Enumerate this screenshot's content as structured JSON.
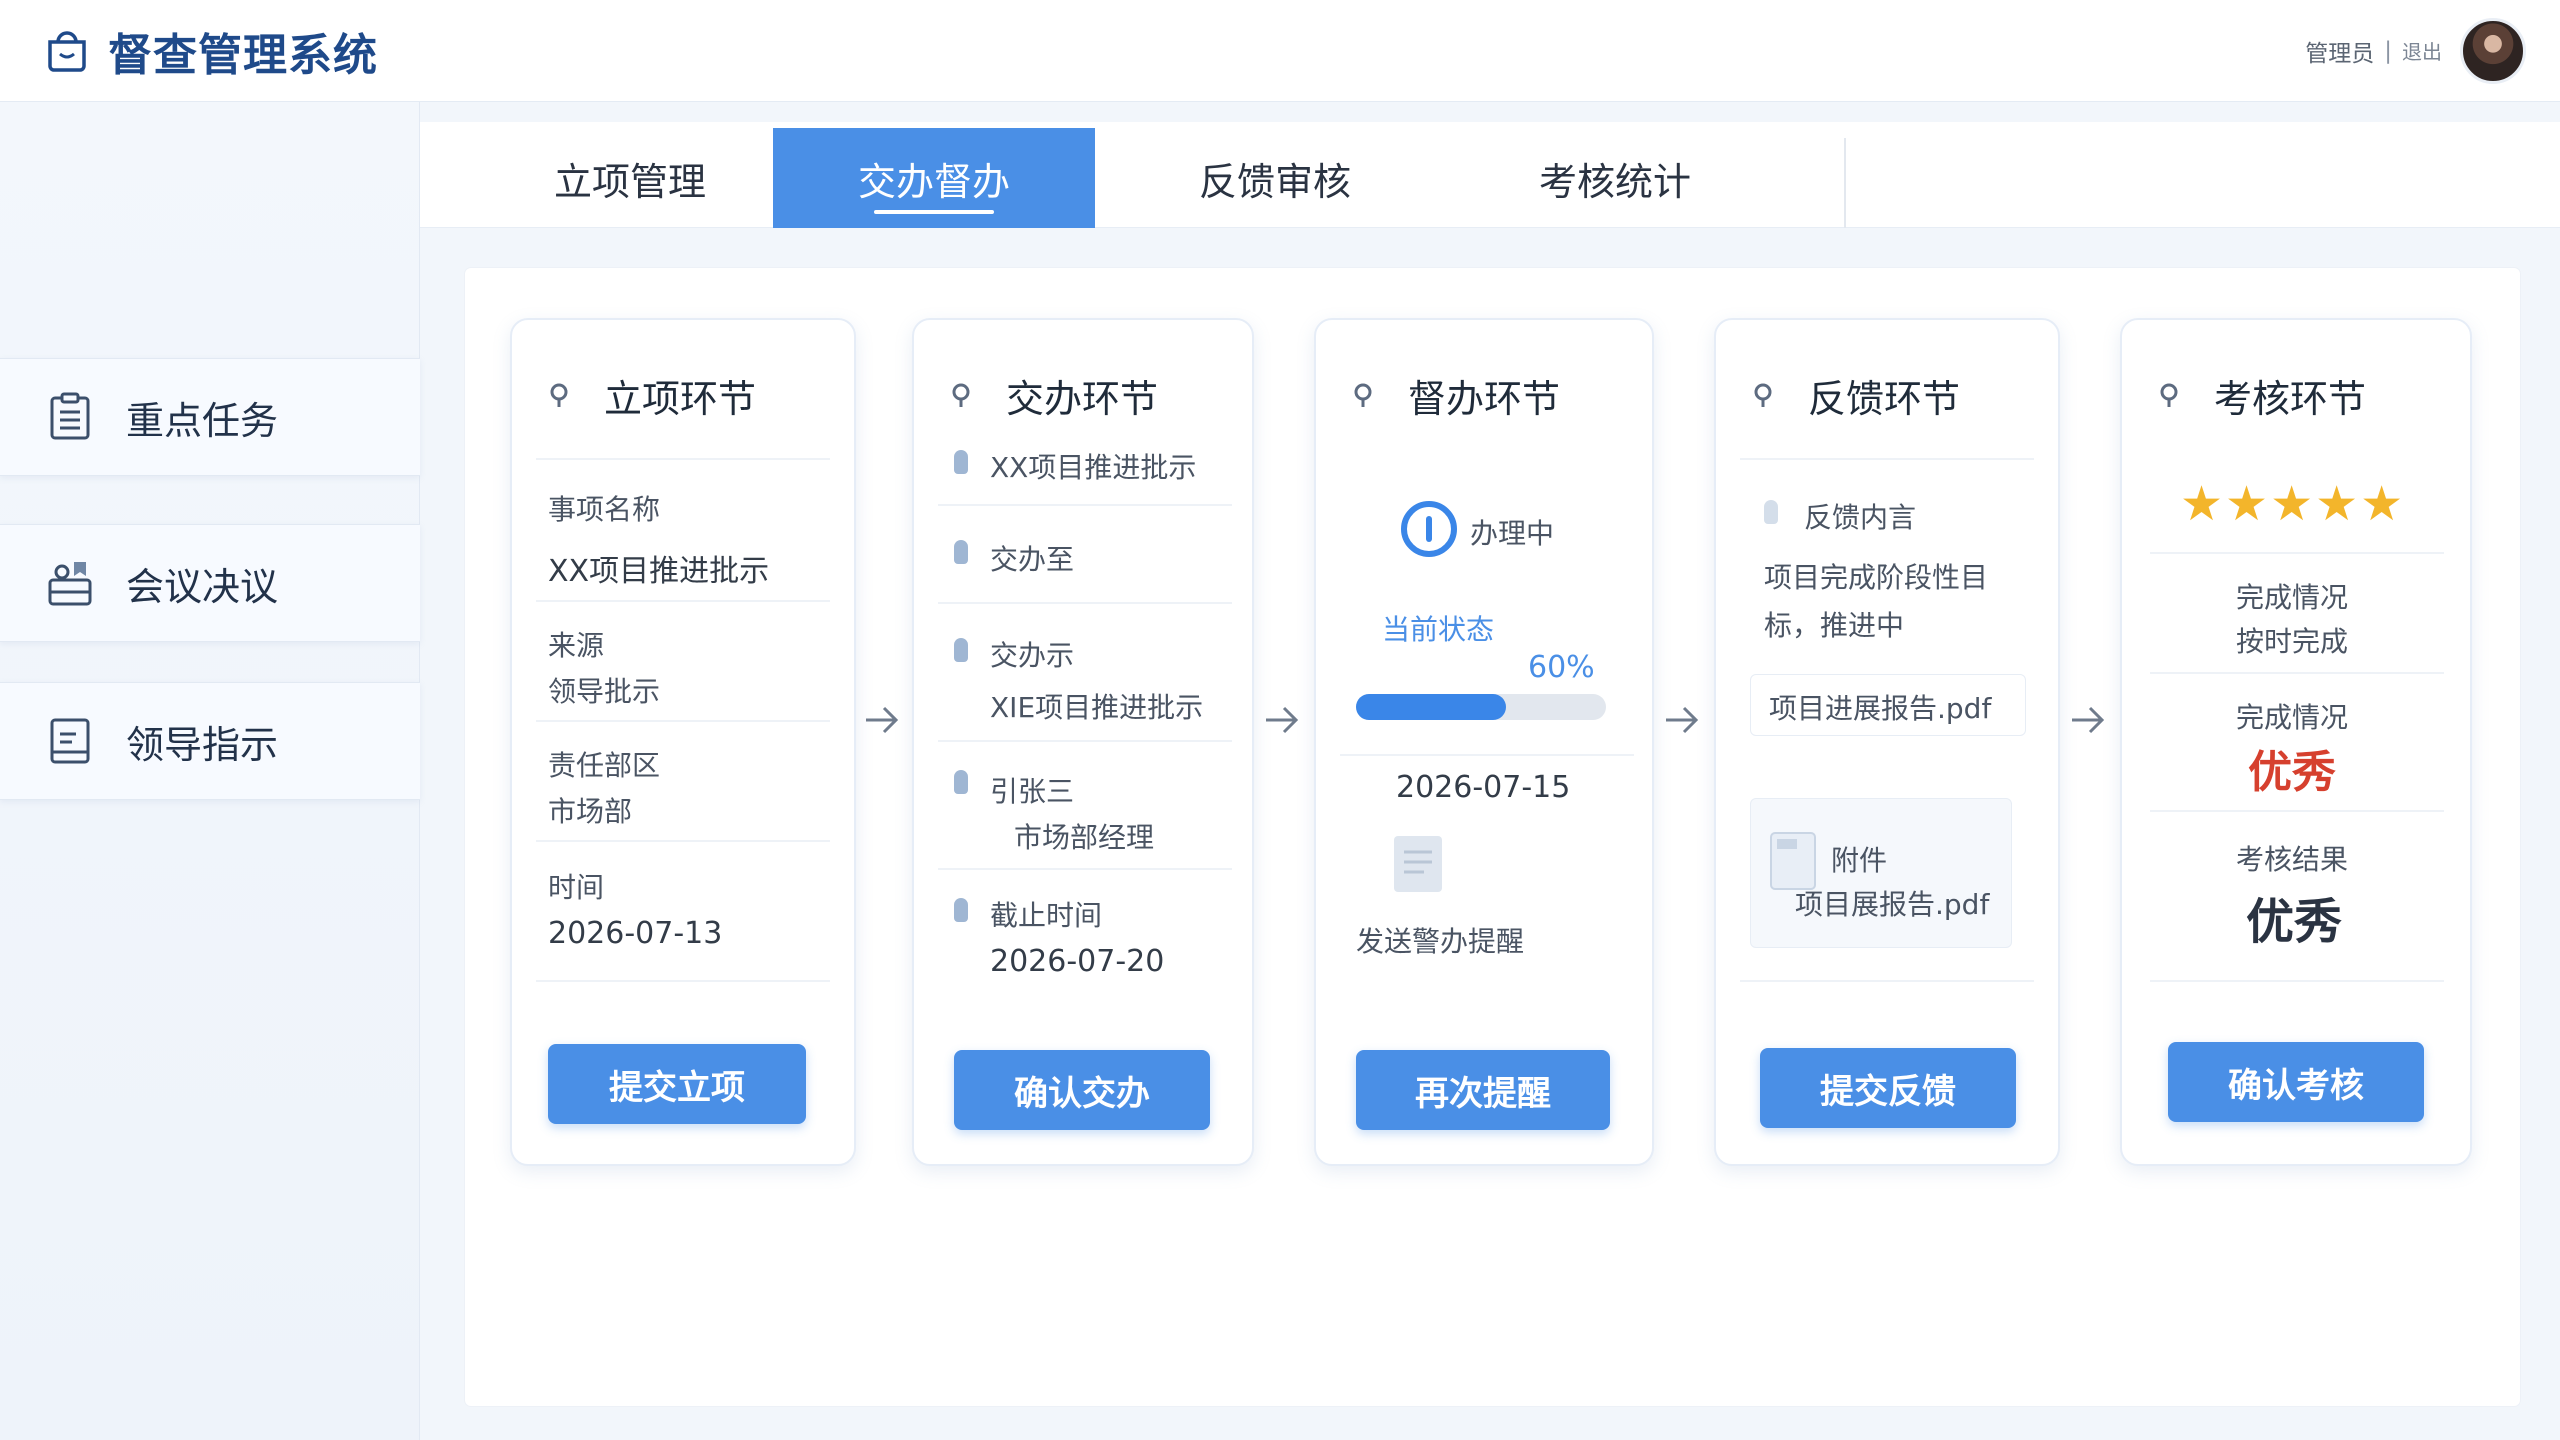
{
  "header": {
    "title": "督查管理系统",
    "user_name": "管理员",
    "separator": "|",
    "logout_label": "退出"
  },
  "sidebar": {
    "items": [
      {
        "label": "重点任务",
        "icon": "clipboard-icon"
      },
      {
        "label": "会议决议",
        "icon": "meeting-icon"
      },
      {
        "label": "领导指示",
        "icon": "document-icon"
      }
    ]
  },
  "tabs": [
    {
      "label": "立项管理",
      "active": false
    },
    {
      "label": "交办督办",
      "active": true
    },
    {
      "label": "反馈审核",
      "active": false
    },
    {
      "label": "考核统计",
      "active": false
    }
  ],
  "stages": {
    "project": {
      "title": "立项环节",
      "name_label": "事项名称",
      "name_value": "XX项目推进批示",
      "source_label": "来源",
      "source_value": "领导批示",
      "dept_label": "责任部区",
      "dept_value": "市场部",
      "time_label": "时间",
      "time_value": "2026-07-13",
      "button": "提交立项"
    },
    "assign": {
      "title": "交办环节",
      "item1": "XX项目推进批示",
      "item2": "交办至",
      "item3_label": "交办示",
      "item3_value": "XIE项目推进批示",
      "person": "引张三",
      "position": "市场部经理",
      "deadline_label": "截止时间",
      "deadline_value": "2026-07-20",
      "button": "确认交办"
    },
    "supervise": {
      "title": "督办环节",
      "status": "办理中",
      "current_status_label": "当前状态",
      "progress_text": "60%",
      "progress": 0.6,
      "date": "2026-07-15",
      "reminder": "发送警办提醒",
      "button": "再次提醒"
    },
    "feedback": {
      "title": "反馈环节",
      "content_label": "反馈内言",
      "content_text_1": "项目完成阶段性目",
      "content_text_2": "标，推进中",
      "file_name": "项目进展报告.pdf",
      "attach_label": "附件",
      "attach_file": "项目展报告.pdf",
      "button": "提交反馈"
    },
    "assess": {
      "title": "考核环节",
      "stars": 5,
      "completion_label": "完成情况",
      "completion_value": "按时完成",
      "quality_label": "完成情况",
      "quality_value": "优秀",
      "result_label": "考核结果",
      "result_value": "优秀",
      "button": "确认考核"
    }
  },
  "colors": {
    "accent": "#4a8fe6",
    "brand": "#1f4a8a",
    "excellent": "#d6402e",
    "star": "#f3b52b"
  }
}
